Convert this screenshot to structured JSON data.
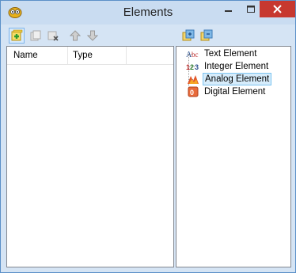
{
  "window": {
    "title": "Elements"
  },
  "table": {
    "columns": [
      "Name",
      "Type"
    ]
  },
  "tree": {
    "items": [
      {
        "label": "Text Element",
        "icon": "text-element-icon"
      },
      {
        "label": "Integer Element",
        "icon": "integer-element-icon"
      },
      {
        "label": "Analog Element",
        "icon": "analog-element-icon",
        "selected": true
      },
      {
        "label": "Digital Element",
        "icon": "digital-element-icon"
      }
    ]
  },
  "colors": {
    "close": "#c7382f",
    "title_bg": "#c9dcf1",
    "frame": "#d5e4f4",
    "selection": "#d6ecfb"
  }
}
